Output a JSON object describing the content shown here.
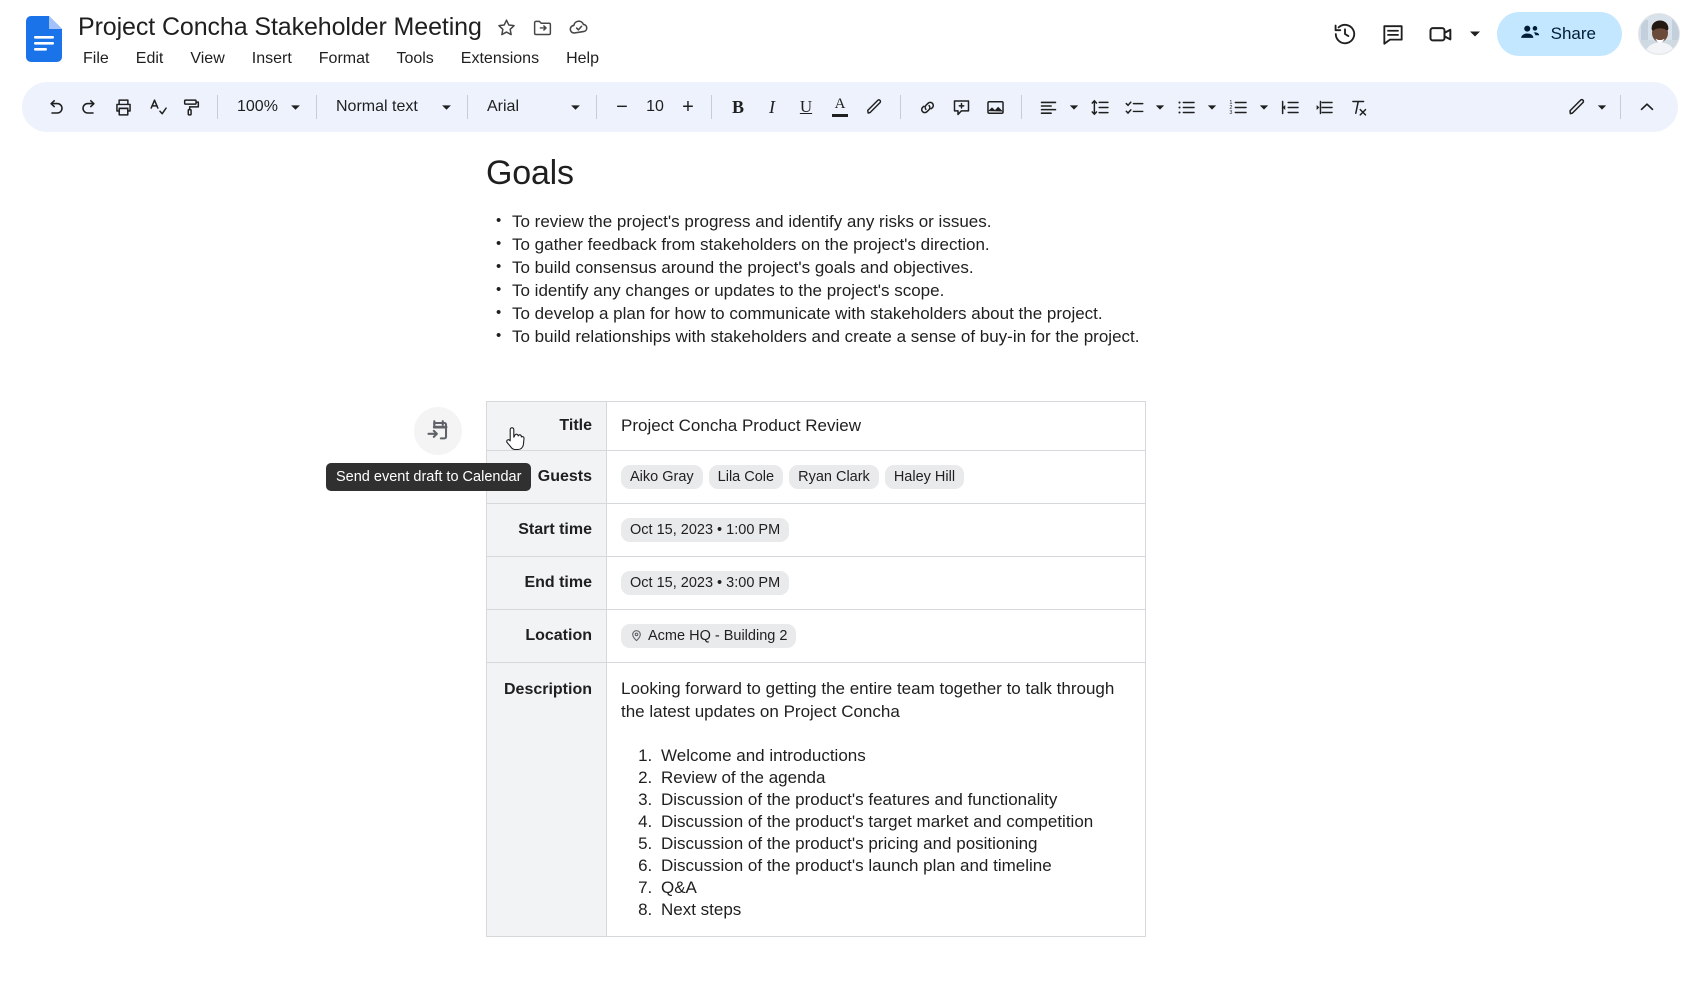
{
  "app": {
    "product": "Google Docs",
    "doc_title": "Project Concha Stakeholder Meeting"
  },
  "header": {
    "title_icons": [
      {
        "name": "star-icon",
        "glyph": "☆"
      },
      {
        "name": "move-to-folder-icon",
        "glyph": "folder-move"
      },
      {
        "name": "cloud-saved-icon",
        "glyph": "cloud-check"
      }
    ],
    "menu": [
      "File",
      "Edit",
      "View",
      "Insert",
      "Format",
      "Tools",
      "Extensions",
      "Help"
    ],
    "right_icons": [
      {
        "name": "version-history-icon",
        "label": "Version history"
      },
      {
        "name": "comment-history-icon",
        "label": "Open comment history"
      },
      {
        "name": "meet-camera-icon",
        "label": "Join a call"
      }
    ],
    "share_label": "Share"
  },
  "toolbar": {
    "undo": "Undo",
    "redo": "Redo",
    "print": "Print",
    "spellcheck": "Spelling and grammar check",
    "paint_format": "Paint format",
    "zoom": "100%",
    "style": "Normal text",
    "font": "Arial",
    "font_size": "10",
    "decrease_font": "−",
    "increase_font": "+",
    "bold": "B",
    "italic": "I",
    "underline": "U",
    "text_color": "A",
    "highlight": "Highlight color",
    "insert_link": "Insert link",
    "add_comment": "Add comment",
    "insert_image": "Insert image",
    "align": "Align",
    "line_spacing": "Line & paragraph spacing",
    "checklist": "Checklist",
    "bulleted_list": "Bulleted list",
    "numbered_list": "Numbered list",
    "decrease_indent": "Decrease indent",
    "increase_indent": "Increase indent",
    "clear_formatting": "Clear formatting",
    "editing_mode": "Editing mode",
    "collapse": "Hide the menus"
  },
  "document": {
    "heading": "Goals",
    "bullets": [
      "To review the project's progress and identify any risks or issues.",
      "To gather feedback from stakeholders on the project's direction.",
      "To build consensus around the project's goals and objectives.",
      "To identify any changes or updates to the project's scope.",
      "To develop a plan for how to communicate with stakeholders about the project.",
      "To build relationships with stakeholders and create a sense of buy-in for the project."
    ],
    "event_table": {
      "rows": [
        {
          "key": "Title",
          "type": "text",
          "value": "Project Concha Product Review"
        },
        {
          "key": "Guests",
          "type": "chips",
          "chips": [
            "Aiko Gray",
            "Lila Cole",
            "Ryan Clark",
            "Haley Hill"
          ]
        },
        {
          "key": "Start time",
          "type": "chip",
          "value": "Oct 15, 2023 • 1:00 PM"
        },
        {
          "key": "End time",
          "type": "chip",
          "value": "Oct 15, 2023 • 3:00 PM"
        },
        {
          "key": "Location",
          "type": "chip-location",
          "value": "Acme HQ - Building 2"
        },
        {
          "key": "Description",
          "type": "description"
        }
      ],
      "description": {
        "paragraph": "Looking forward to getting the entire team together to talk through the latest updates on Project Concha",
        "agenda": [
          "Welcome and introductions",
          "Review of the agenda",
          "Discussion of the product's features and functionality",
          "Discussion of the product's target market and competition",
          "Discussion of the product's pricing and positioning",
          "Discussion of the product's launch plan and timeline",
          "Q&A",
          "Next steps"
        ]
      }
    },
    "calendar_action": {
      "icon_name": "send-to-calendar-icon",
      "tooltip": "Send event draft to Calendar"
    }
  },
  "colors": {
    "docs_blue": "#1a73e8",
    "toolbar_bg": "#edf2fc",
    "share_bg": "#c2e7ff",
    "chip_bg": "#e9eaec",
    "table_header_bg": "#f1f3f4",
    "tooltip_bg": "#303030",
    "text": "#1f1f1f"
  }
}
